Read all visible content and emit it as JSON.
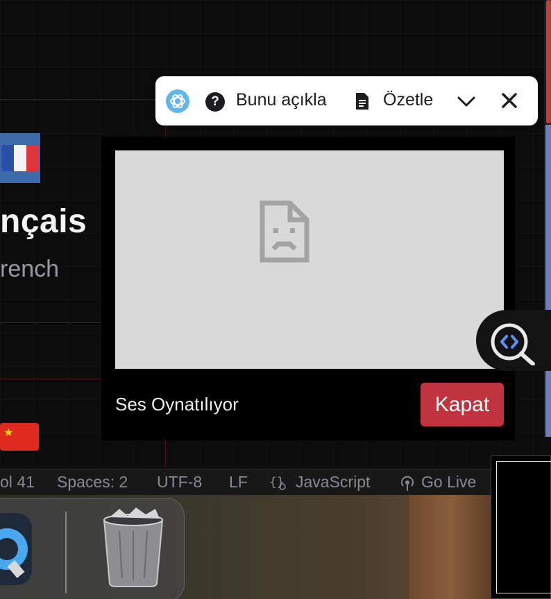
{
  "background": {
    "language_native": "nçais",
    "language_english": "rench"
  },
  "toolbar": {
    "explain_label": "Bunu açıkla",
    "summarize_label": "Özetle"
  },
  "dialog": {
    "status_text": "Ses Oynatılıyor",
    "close_label": "Kapat"
  },
  "status_bar": {
    "position": "ol 41",
    "spaces": "Spaces: 2",
    "encoding": "UTF-8",
    "line_ending": "LF",
    "language": "JavaScript",
    "go_live": "Go Live"
  },
  "colors": {
    "accent_red": "#c1343f",
    "toolbar_bg": "#ffffff",
    "frame_bg": "#d9d9d9"
  },
  "icons": [
    "chatgpt-icon",
    "help-icon",
    "document-icon",
    "chevron-down-icon",
    "close-icon",
    "broken-document-icon",
    "code-search-icon",
    "braces-icon",
    "broadcast-icon",
    "trash-icon",
    "quicktime-icon"
  ]
}
